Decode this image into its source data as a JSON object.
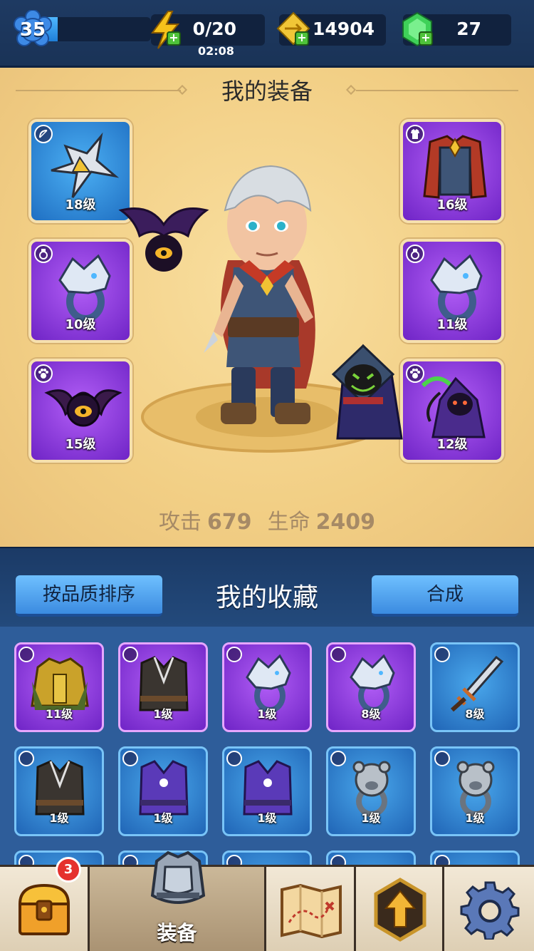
{
  "topbar": {
    "level": "35",
    "level_progress": 0.15,
    "energy": "0/20",
    "energy_timer": "02:08",
    "gold": "14904",
    "gems": "27",
    "colors": {
      "energy": "#f5c21b",
      "gold": "#f0c637",
      "gem": "#3fd159",
      "add": "#4ec23a"
    }
  },
  "equipment": {
    "title": "我的装备",
    "left_slots": [
      {
        "id": "weapon",
        "category_icon": "bow-icon",
        "rarity": "blue",
        "item": "throwing-star",
        "level": "18级"
      },
      {
        "id": "ring",
        "category_icon": "ring-icon",
        "rarity": "purple",
        "item": "wolf-ring",
        "level": "10级"
      },
      {
        "id": "pet",
        "category_icon": "paw-icon",
        "rarity": "purple",
        "item": "bat-pet",
        "level": "15级"
      }
    ],
    "right_slots": [
      {
        "id": "armor",
        "category_icon": "armor-icon",
        "rarity": "purple",
        "item": "red-robe",
        "level": "16级"
      },
      {
        "id": "ring2",
        "category_icon": "ring-icon",
        "rarity": "purple",
        "item": "wolf-ring",
        "level": "11级"
      },
      {
        "id": "pet2",
        "category_icon": "paw-icon",
        "rarity": "purple",
        "item": "reaper-pet",
        "level": "12级"
      }
    ],
    "stats": {
      "attack_label": "攻击",
      "attack_value": "679",
      "hp_label": "生命",
      "hp_value": "2409"
    }
  },
  "collection": {
    "sort_button": "按品质排序",
    "title": "我的收藏",
    "merge_button": "合成",
    "items": [
      {
        "category_icon": "armor-icon",
        "rarity": "purple",
        "item": "gold-armor",
        "level": "11级"
      },
      {
        "category_icon": "armor-icon",
        "rarity": "purple",
        "item": "dark-vest",
        "level": "1级"
      },
      {
        "category_icon": "ring-icon",
        "rarity": "purple",
        "item": "wolf-ring",
        "level": "1级"
      },
      {
        "category_icon": "ring-icon",
        "rarity": "purple",
        "item": "wolf-ring",
        "level": "8级"
      },
      {
        "category_icon": "bow-icon",
        "rarity": "blue",
        "item": "saw-sword",
        "level": "8级"
      },
      {
        "category_icon": "armor-icon",
        "rarity": "blue",
        "item": "dark-vest",
        "level": "1级"
      },
      {
        "category_icon": "armor-icon",
        "rarity": "blue",
        "item": "mage-robe",
        "level": "1级"
      },
      {
        "category_icon": "armor-icon",
        "rarity": "blue",
        "item": "mage-robe",
        "level": "1级"
      },
      {
        "category_icon": "ring-icon",
        "rarity": "blue",
        "item": "bear-ring",
        "level": "1级"
      },
      {
        "category_icon": "ring-icon",
        "rarity": "blue",
        "item": "bear-ring",
        "level": "1级"
      }
    ]
  },
  "nav": {
    "items": [
      {
        "id": "chest",
        "icon": "treasure-chest-icon",
        "badge": "3"
      },
      {
        "id": "equipment",
        "icon": "armor-icon",
        "label": "装备",
        "active": true
      },
      {
        "id": "map",
        "icon": "map-icon"
      },
      {
        "id": "upgrade",
        "icon": "upgrade-arrow-icon"
      },
      {
        "id": "settings",
        "icon": "gear-icon"
      }
    ]
  }
}
